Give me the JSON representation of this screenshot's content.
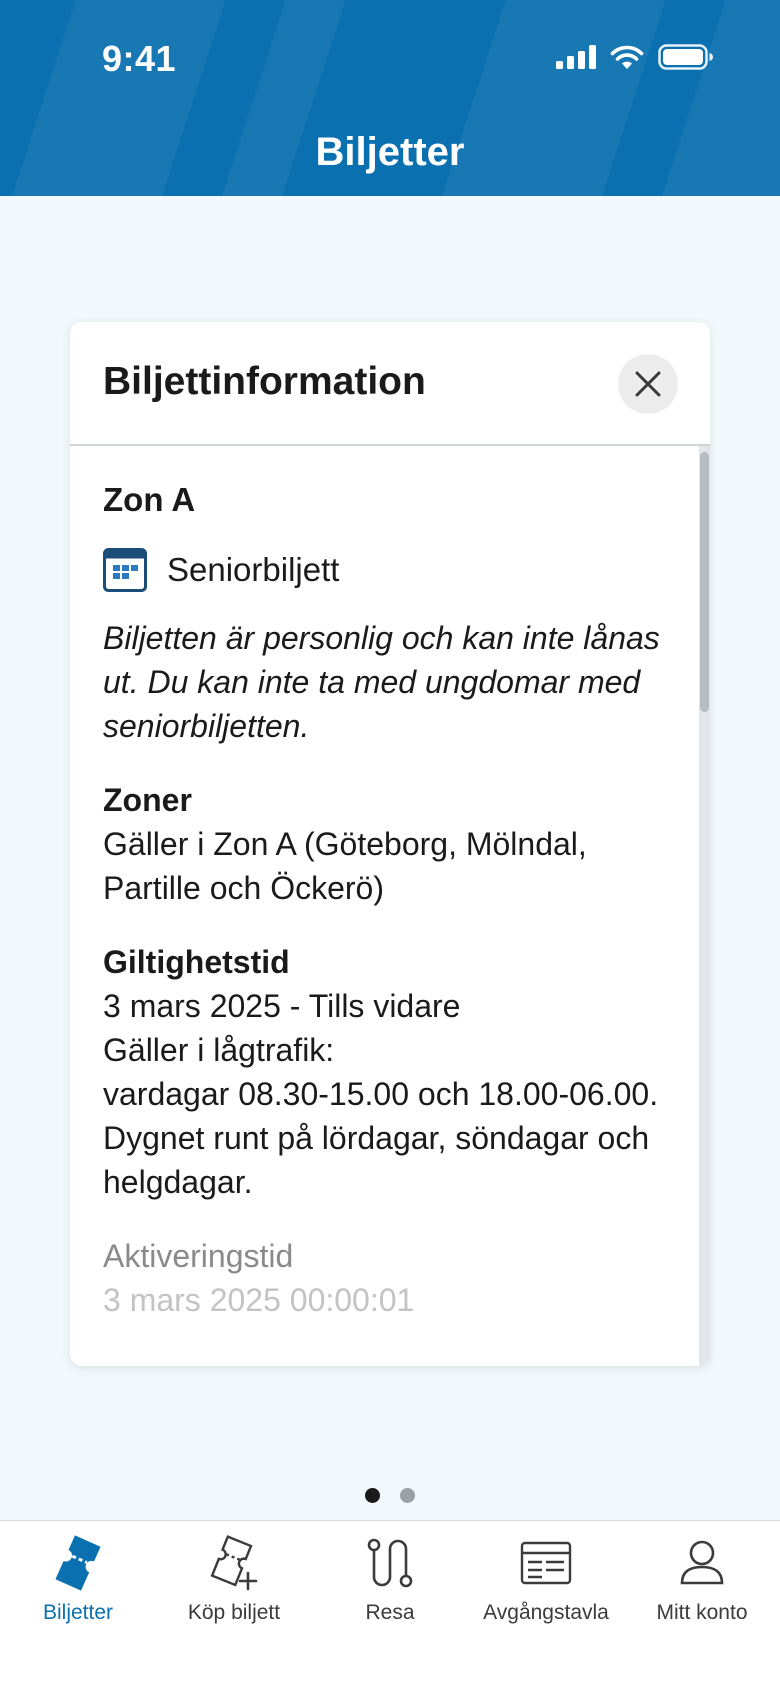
{
  "status": {
    "time": "9:41"
  },
  "header": {
    "title": "Biljetter"
  },
  "card": {
    "title": "Biljettinformation",
    "zone_title": "Zon A",
    "ticket_type": "Seniorbiljett",
    "note": "Biljetten är personlig och kan inte lånas ut. Du kan inte ta med ungdomar med seniorbiljetten.",
    "zones": {
      "heading": "Zoner",
      "value": "Gäller i Zon A (Göteborg, Mölndal, Partille och Öckerö)"
    },
    "validity": {
      "heading": "Giltighetstid",
      "line1": "3 mars 2025 - Tills vidare",
      "line2": "Gäller i lågtrafik:",
      "line3": "vardagar 08.30-15.00 och 18.00-06.00. Dygnet runt på lördagar, söndagar och helgdagar."
    },
    "activation": {
      "heading": "Aktiveringstid",
      "value": "3 mars 2025 00:00:01"
    }
  },
  "pager": {
    "count": 2,
    "active": 1
  },
  "tabbar": {
    "items": [
      {
        "label": "Biljetter",
        "icon": "ticket-icon",
        "active": true
      },
      {
        "label": "Köp biljett",
        "icon": "buy-ticket-icon",
        "active": false
      },
      {
        "label": "Resa",
        "icon": "route-icon",
        "active": false
      },
      {
        "label": "Avgångstavla",
        "icon": "departure-board-icon",
        "active": false
      },
      {
        "label": "Mitt konto",
        "icon": "account-icon",
        "active": false
      }
    ]
  },
  "colors": {
    "brand": "#0a70b0",
    "background": "#f1f9fc",
    "ticket_icon": "#1c4d78"
  }
}
